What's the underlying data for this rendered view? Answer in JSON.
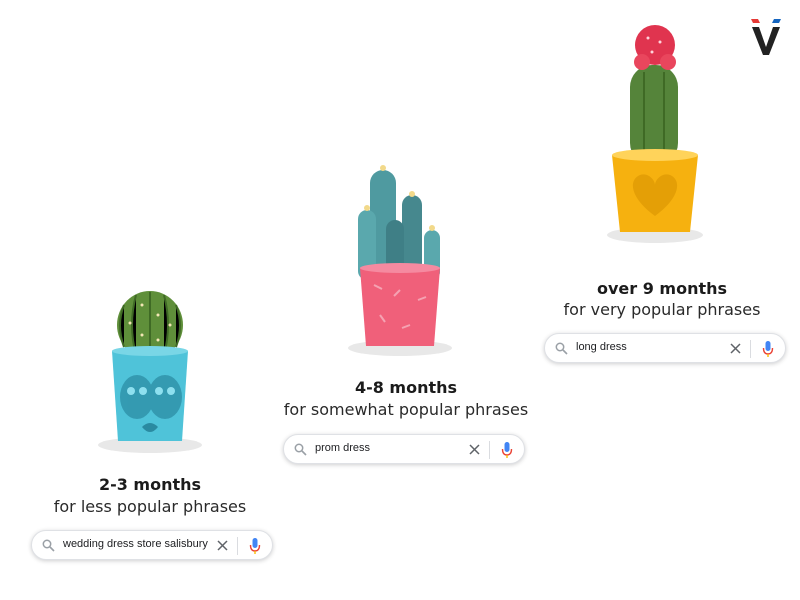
{
  "brand": {
    "logo_icon": "brand-v-logo",
    "colors": [
      "#e53935",
      "#1565c0",
      "#222222"
    ]
  },
  "stages": [
    {
      "title": "2-3 months",
      "subtitle": "for less popular phrases",
      "query": "wedding dress store salisbury",
      "pot_color": "#4fc3d9",
      "plant": "round-cactus-icon"
    },
    {
      "title": "4-8 months",
      "subtitle": "for somewhat popular phrases",
      "query": "prom dress",
      "pot_color": "#f0607a",
      "plant": "column-cactus-icon"
    },
    {
      "title": "over 9 months",
      "subtitle": "for very popular phrases",
      "query": "long dress",
      "pot_color": "#f6b10f",
      "plant": "moon-cactus-icon"
    }
  ],
  "search_icons": [
    "search-icon",
    "clear-icon",
    "mic-icon"
  ]
}
